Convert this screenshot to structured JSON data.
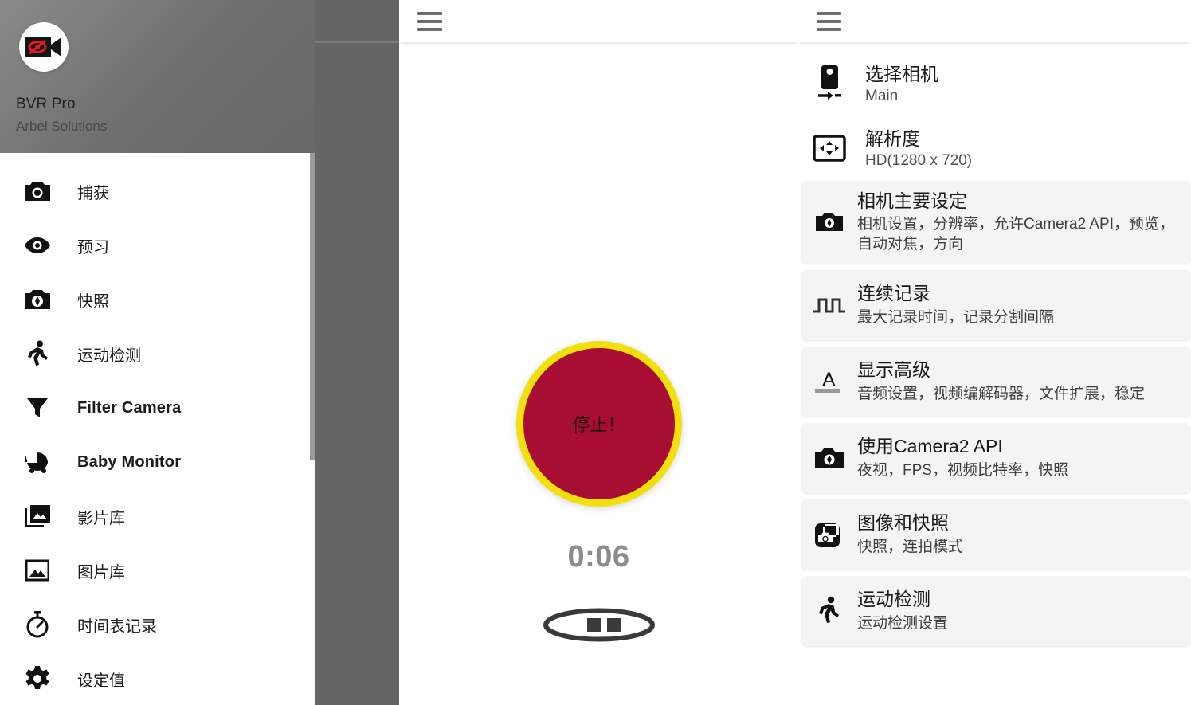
{
  "drawer": {
    "app_name": "BVR Pro",
    "company": "Arbel Solutions",
    "logo_icon": "hidden-video-camera-icon",
    "items": [
      {
        "label": "捕获",
        "icon": "camera-icon",
        "latin": false
      },
      {
        "label": "预习",
        "icon": "eye-icon",
        "latin": false
      },
      {
        "label": "快照",
        "icon": "snapshot-icon",
        "latin": false
      },
      {
        "label": "运动检测",
        "icon": "running-person-icon",
        "latin": false
      },
      {
        "label": "Filter Camera",
        "icon": "filter-icon",
        "latin": true
      },
      {
        "label": "Baby Monitor",
        "icon": "stroller-icon",
        "latin": true
      },
      {
        "label": "影片库",
        "icon": "video-library-icon",
        "latin": false
      },
      {
        "label": "图片库",
        "icon": "image-library-icon",
        "latin": false
      },
      {
        "label": "时间表记录",
        "icon": "stopwatch-icon",
        "latin": false
      },
      {
        "label": "设定值",
        "icon": "gear-icon",
        "latin": false
      }
    ]
  },
  "center": {
    "menu_icon": "hamburger-menu-icon",
    "stop_label": "停止！",
    "timer": "0:06",
    "pause_icon": "pause-button-icon",
    "colors": {
      "stop_fill": "#a80d33",
      "stop_ring": "#f2e00e",
      "timer_text": "#8c8c8c"
    }
  },
  "settings": {
    "menu_icon": "hamburger-menu-icon",
    "plain_items": [
      {
        "title": "选择相机",
        "sub": "Main",
        "icon": "select-camera-icon"
      },
      {
        "title": "解析度",
        "sub": "HD(1280 x 720)",
        "icon": "resolution-icon"
      }
    ],
    "cards": [
      {
        "title": "相机主要设定",
        "sub": "相机设置，分辨率，允许Camera2 API，预览，自动对焦，方向",
        "icon": "camera-settings-icon"
      },
      {
        "title": "连续记录",
        "sub": "最大记录时间，记录分割间隔",
        "icon": "pulse-wave-icon"
      },
      {
        "title": "显示高级",
        "sub": "音频设置，视频编解码器，文件扩展，稳定",
        "icon": "text-format-icon"
      },
      {
        "title": "使用Camera2 API",
        "sub": "夜视，FPS，视频比特率，快照",
        "icon": "camera-api-icon"
      },
      {
        "title": "图像和快照",
        "sub": "快照，连拍模式",
        "icon": "burst-photos-icon"
      },
      {
        "title": "运动检测",
        "sub": "运动检测设置",
        "icon": "running-person-icon"
      }
    ]
  }
}
